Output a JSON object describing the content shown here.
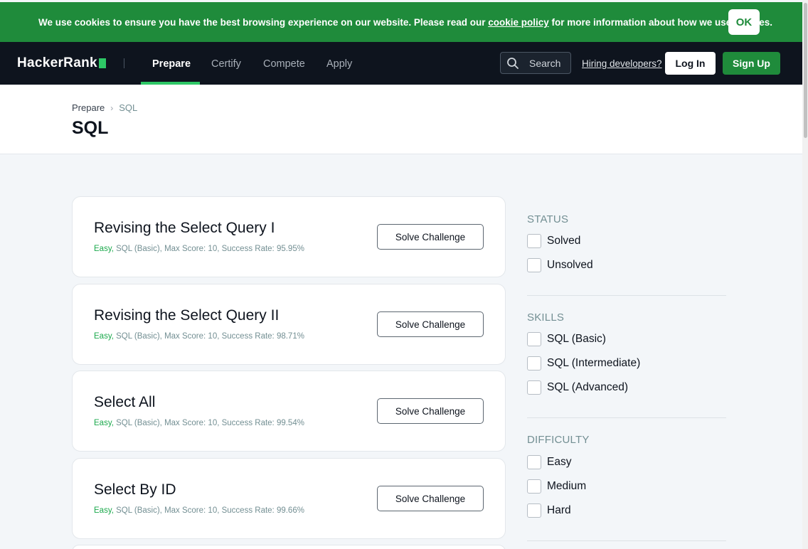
{
  "cookie": {
    "text_before": "We use cookies to ensure you have the best browsing experience on our website. Please read our ",
    "link": "cookie policy",
    "text_after": " for more information about how we use cookies.",
    "ok_label": "OK"
  },
  "nav": {
    "logo": "HackerRank",
    "links": [
      "Prepare",
      "Certify",
      "Compete",
      "Apply"
    ],
    "active": "Prepare",
    "search_label": "Search",
    "hiring": "Hiring developers?",
    "login": "Log In",
    "signup": "Sign Up"
  },
  "header": {
    "breadcrumb": [
      "Prepare",
      "SQL"
    ],
    "title": "SQL"
  },
  "challenges": [
    {
      "title": "Revising the Select Query I",
      "difficulty": "Easy,",
      "meta": " SQL (Basic), Max Score: 10, Success Rate: 95.95%",
      "button": "Solve Challenge"
    },
    {
      "title": "Revising the Select Query II",
      "difficulty": "Easy,",
      "meta": " SQL (Basic), Max Score: 10, Success Rate: 98.71%",
      "button": "Solve Challenge"
    },
    {
      "title": "Select All",
      "difficulty": "Easy,",
      "meta": " SQL (Basic), Max Score: 10, Success Rate: 99.54%",
      "button": "Solve Challenge"
    },
    {
      "title": "Select By ID",
      "difficulty": "Easy,",
      "meta": " SQL (Basic), Max Score: 10, Success Rate: 99.66%",
      "button": "Solve Challenge"
    }
  ],
  "filters": {
    "status": {
      "heading": "STATUS",
      "options": [
        "Solved",
        "Unsolved"
      ]
    },
    "skills": {
      "heading": "SKILLS",
      "options": [
        "SQL (Basic)",
        "SQL (Intermediate)",
        "SQL (Advanced)"
      ]
    },
    "difficulty": {
      "heading": "DIFFICULTY",
      "options": [
        "Easy",
        "Medium",
        "Hard"
      ]
    }
  },
  "colors": {
    "brand_green": "#1f8b3b",
    "accent_green": "#2ec866",
    "nav_bg": "#0e141e"
  }
}
